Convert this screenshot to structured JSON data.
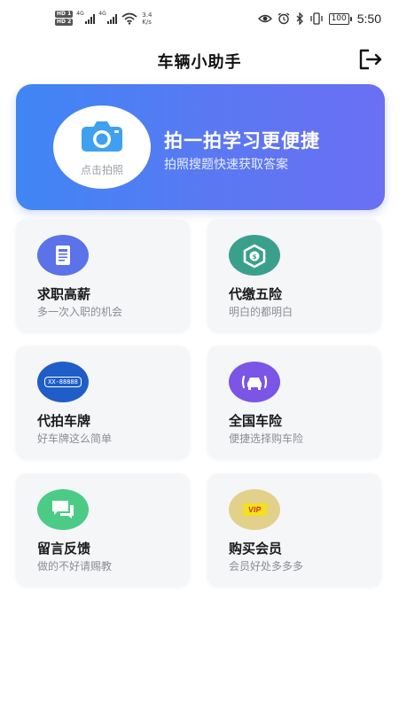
{
  "status_bar": {
    "hd1": "HD 1",
    "hd2": "HD 2",
    "net1": "4G",
    "net2": "4G",
    "speed_value": "3.4",
    "speed_unit": "K/s",
    "battery": "100",
    "time": "5:50",
    "icons": [
      "eye-icon",
      "alarm-icon",
      "bluetooth-icon",
      "vibrate-icon",
      "battery-icon"
    ]
  },
  "header": {
    "title": "车辆小助手",
    "logout_icon": "logout-icon"
  },
  "banner": {
    "camera_label": "点击拍照",
    "title": "拍一拍学习更便捷",
    "subtitle": "拍照搜题快速获取答案",
    "icon": "camera-icon"
  },
  "cards": [
    {
      "title": "求职高薪",
      "subtitle": "多一次入职的机会",
      "icon": "document-icon",
      "color": "#5b72e8"
    },
    {
      "title": "代缴五险",
      "subtitle": "明白的都明白",
      "icon": "insurance-hands-icon",
      "color": "#3aa08c"
    },
    {
      "title": "代拍车牌",
      "subtitle": "好车牌这么简单",
      "icon": "license-plate-icon",
      "color": "#1f5ec8",
      "plate_text": "XX-88888"
    },
    {
      "title": "全国车险",
      "subtitle": "便捷选择购车险",
      "icon": "car-insurance-icon",
      "color": "#7a55e6"
    },
    {
      "title": "留言反馈",
      "subtitle": "做的不好请赐教",
      "icon": "chat-icon",
      "color": "#4ccb86"
    },
    {
      "title": "购买会员",
      "subtitle": "会员好处多多多",
      "icon": "vip-icon",
      "color": "#e3d08a",
      "vip_text": "VIP"
    }
  ]
}
